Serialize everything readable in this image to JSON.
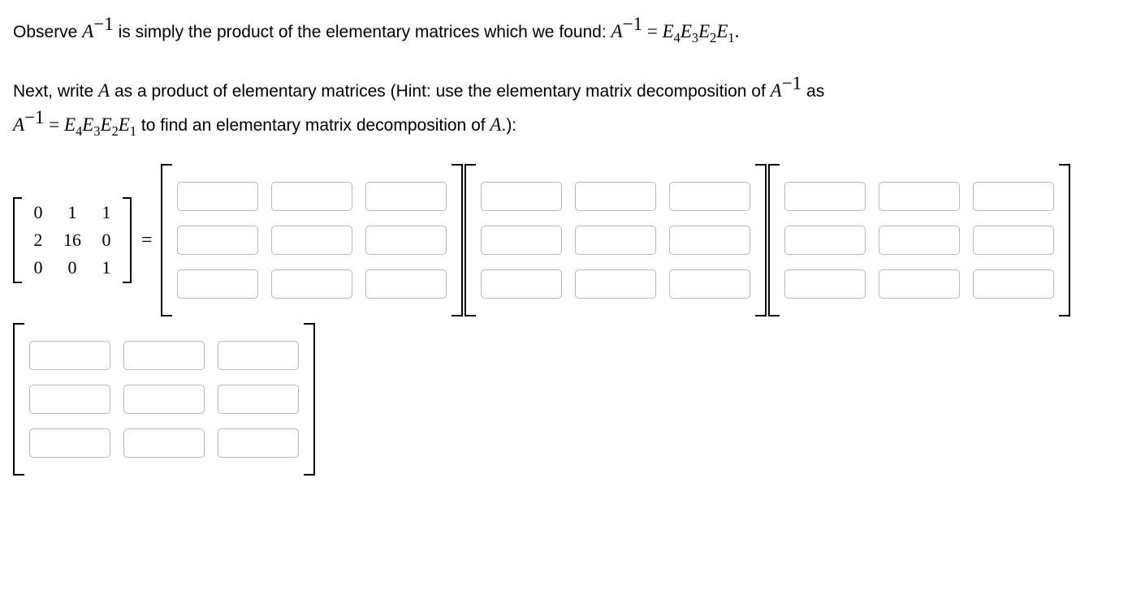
{
  "para1": {
    "t1": "Observe ",
    "A": "A",
    "sup_neg1": "−1",
    "t2": " is simply the product of the elementary matrices which we found: ",
    "eq": " = ",
    "E4": "E",
    "s4": "4",
    "E3": "E",
    "s3": "3",
    "E2": "E",
    "s2": "2",
    "E1": "E",
    "s1": "1",
    "dot": "."
  },
  "para2": {
    "t1": "Next, write ",
    "A": "A",
    "t2": " as a product of elementary matrices (Hint: use the elementary matrix decomposition of ",
    "sup_neg1": "−1",
    "t3": " as ",
    "eq": " = ",
    "E4": "E",
    "s4": "4",
    "E3": "E",
    "s3": "3",
    "E2": "E",
    "s2": "2",
    "E1": "E",
    "s1": "1",
    "t4": " to find an elementary matrix decomposition of ",
    "t5": ".):"
  },
  "lhs_matrix": {
    "rows": [
      [
        "0",
        "1",
        "1"
      ],
      [
        "2",
        "16",
        "0"
      ],
      [
        "0",
        "0",
        "1"
      ]
    ]
  },
  "equals": "=",
  "input_matrices": [
    {
      "rows": 3,
      "cols": 3
    },
    {
      "rows": 3,
      "cols": 3
    },
    {
      "rows": 3,
      "cols": 3
    },
    {
      "rows": 3,
      "cols": 3
    }
  ]
}
